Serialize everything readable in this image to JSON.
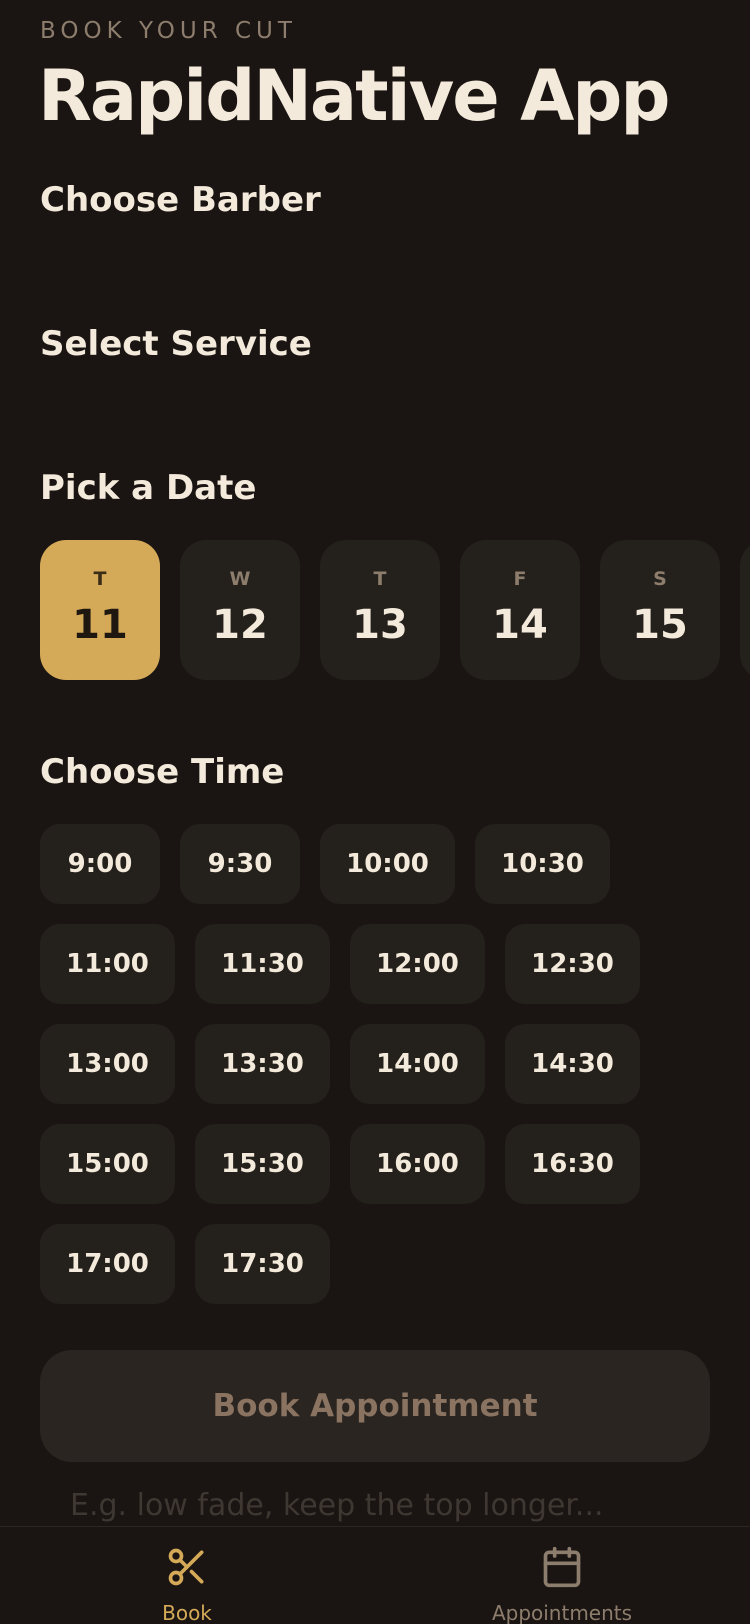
{
  "header": {
    "eyebrow": "BOOK YOUR CUT",
    "title": "RapidNative App"
  },
  "sections": {
    "barber": "Choose Barber",
    "service": "Select Service",
    "date": "Pick a Date",
    "time": "Choose Time"
  },
  "dates": [
    {
      "dow": "T",
      "day": "11",
      "selected": true
    },
    {
      "dow": "W",
      "day": "12",
      "selected": false
    },
    {
      "dow": "T",
      "day": "13",
      "selected": false
    },
    {
      "dow": "F",
      "day": "14",
      "selected": false
    },
    {
      "dow": "S",
      "day": "15",
      "selected": false
    }
  ],
  "times": [
    "9:00",
    "9:30",
    "10:00",
    "10:30",
    "11:00",
    "11:30",
    "12:00",
    "12:30",
    "13:00",
    "13:30",
    "14:00",
    "14:30",
    "15:00",
    "15:30",
    "16:00",
    "16:30",
    "17:00",
    "17:30"
  ],
  "book_button": "Book Appointment",
  "notes": {
    "placeholder": "E.g. low fade, keep the top longer...",
    "value": ""
  },
  "tabs": [
    {
      "label": "Book",
      "icon": "scissors-icon",
      "active": true
    },
    {
      "label": "Appointments",
      "icon": "calendar-icon",
      "active": false
    }
  ],
  "colors": {
    "background": "#1a1512",
    "accent": "#d4a957",
    "card": "#24201c",
    "text": "#f3eadb",
    "muted": "#8d7d6c"
  }
}
